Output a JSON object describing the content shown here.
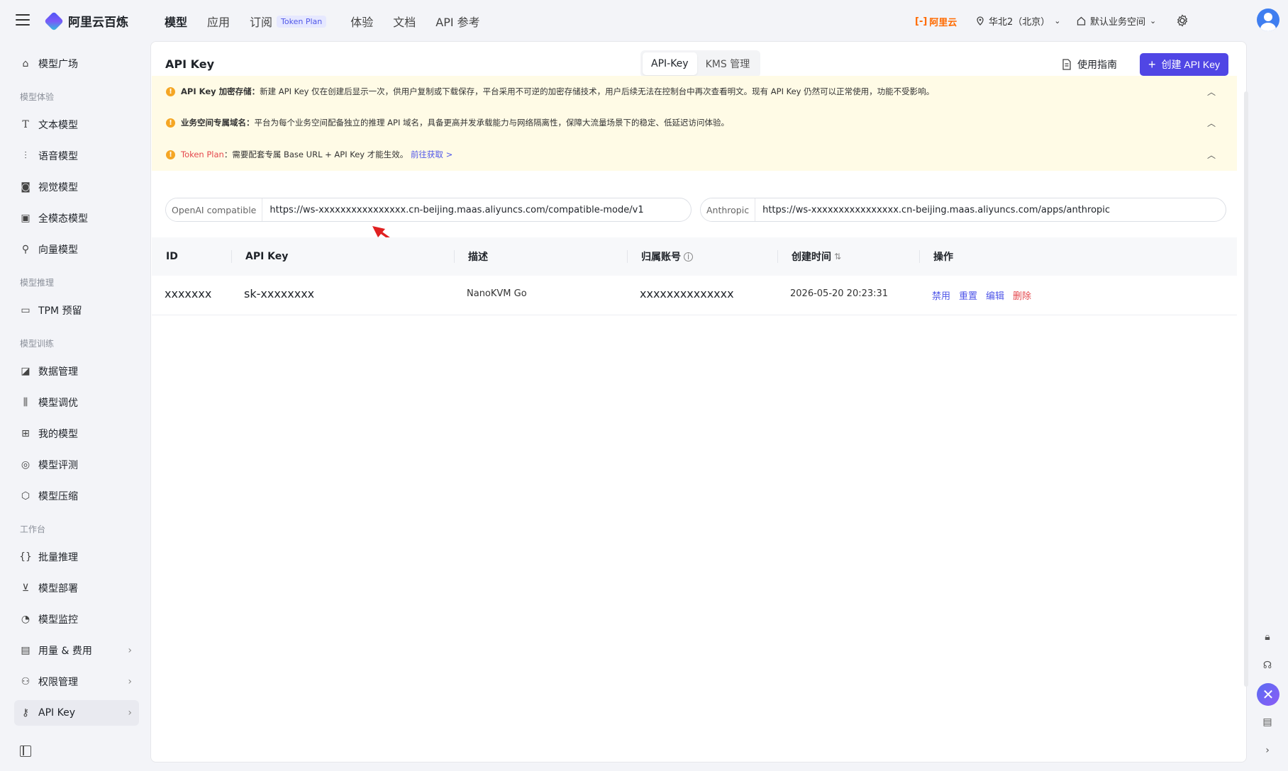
{
  "header": {
    "logo_text": "阿里云百炼",
    "nav": [
      {
        "label": "模型",
        "active": true
      },
      {
        "label": "应用"
      },
      {
        "label": "订阅",
        "badge": "Token Plan"
      },
      {
        "label": "体验"
      },
      {
        "label": "文档"
      },
      {
        "label": "API 参考"
      }
    ],
    "aliyun_label": "阿里云",
    "region": "华北2（北京）",
    "workspace": "默认业务空间"
  },
  "sidebar": {
    "top_item": "模型广场",
    "groups": [
      {
        "title": "模型体验",
        "items": [
          "文本模型",
          "语音模型",
          "视觉模型",
          "全模态模型",
          "向量模型"
        ]
      },
      {
        "title": "模型推理",
        "items": [
          "TPM 预留"
        ]
      },
      {
        "title": "模型训练",
        "items": [
          "数据管理",
          "模型调优",
          "我的模型",
          "模型评测",
          "模型压缩"
        ]
      },
      {
        "title": "工作台",
        "items": [
          "批量推理",
          "模型部署",
          "模型监控",
          "用量 & 费用",
          "权限管理",
          "API Key"
        ]
      }
    ],
    "active": "API Key"
  },
  "main": {
    "title": "API Key",
    "tabs": [
      "API-Key",
      "KMS 管理"
    ],
    "guide_label": "使用指南",
    "create_label": "创建 API Key",
    "notices": [
      {
        "bold": "API Key 加密存储：",
        "text": "新建 API Key 仅在创建后显示一次，供用户复制或下载保存，平台采用不可逆的加密存储技术，用户后续无法在控制台中再次查看明文。现有 API Key 仍然可以正常使用，功能不受影响。"
      },
      {
        "bold": "业务空间专属域名：",
        "text": "平台为每个业务空间配备独立的推理 API 域名，具备更高并发承载能力与网络隔离性，保障大流量场景下的稳定、低延迟访问体验。"
      },
      {
        "red": "Token Plan",
        "text": "：需要配套专属 Base URL + API Key 才能生效。",
        "link": "前往获取 >"
      }
    ],
    "urls": [
      {
        "tag": "OpenAI compatible",
        "value": "https://ws-xxxxxxxxxxxxxxxx.cn-beijing.maas.aliyuncs.com/compatible-mode/v1"
      },
      {
        "tag": "Anthropic",
        "value": "https://ws-xxxxxxxxxxxxxxxx.cn-beijing.maas.aliyuncs.com/apps/anthropic"
      }
    ],
    "table": {
      "columns": [
        "ID",
        "API Key",
        "描述",
        "归属账号",
        "创建时间",
        "操作"
      ],
      "rows": [
        {
          "id": "xxxxxxx",
          "key": "sk-xxxxxxxx",
          "desc": "NanoKVM Go",
          "account": "xxxxxxxxxxxxxx",
          "created": "2026-05-20 20:23:31"
        }
      ],
      "actions": [
        "禁用",
        "重置",
        "编辑",
        "删除"
      ]
    }
  }
}
